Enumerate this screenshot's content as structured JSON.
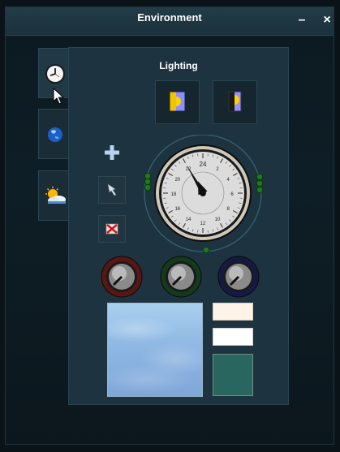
{
  "window": {
    "title": "Environment",
    "minimize_label": "–",
    "close_label": "×"
  },
  "tabs": [
    {
      "icon": "clock-icon",
      "active": true
    },
    {
      "icon": "globe-icon",
      "active": false
    },
    {
      "icon": "weather-icon",
      "active": false
    }
  ],
  "panel": {
    "title": "Lighting",
    "presets": [
      {
        "icon": "sun-day-preset-icon"
      },
      {
        "icon": "moon-night-preset-icon"
      }
    ],
    "actions": [
      {
        "icon": "add-icon"
      },
      {
        "icon": "pointer-icon"
      },
      {
        "icon": "delete-icon"
      }
    ],
    "clock": {
      "dial_numbers": [
        "24",
        "2",
        "4",
        "6",
        "8",
        "10",
        "12",
        "14",
        "16",
        "18",
        "20",
        "22"
      ],
      "time": "22:30"
    },
    "knobs": [
      {
        "name": "red",
        "ring_color": "#5a1515"
      },
      {
        "name": "green",
        "ring_color": "#143a1c"
      },
      {
        "name": "blue",
        "ring_color": "#151a45"
      }
    ],
    "swatches": {
      "sky": "#8fb8e3",
      "cream": "#fdf3e6",
      "white": "#ffffff",
      "teal": "#2a6660"
    }
  }
}
